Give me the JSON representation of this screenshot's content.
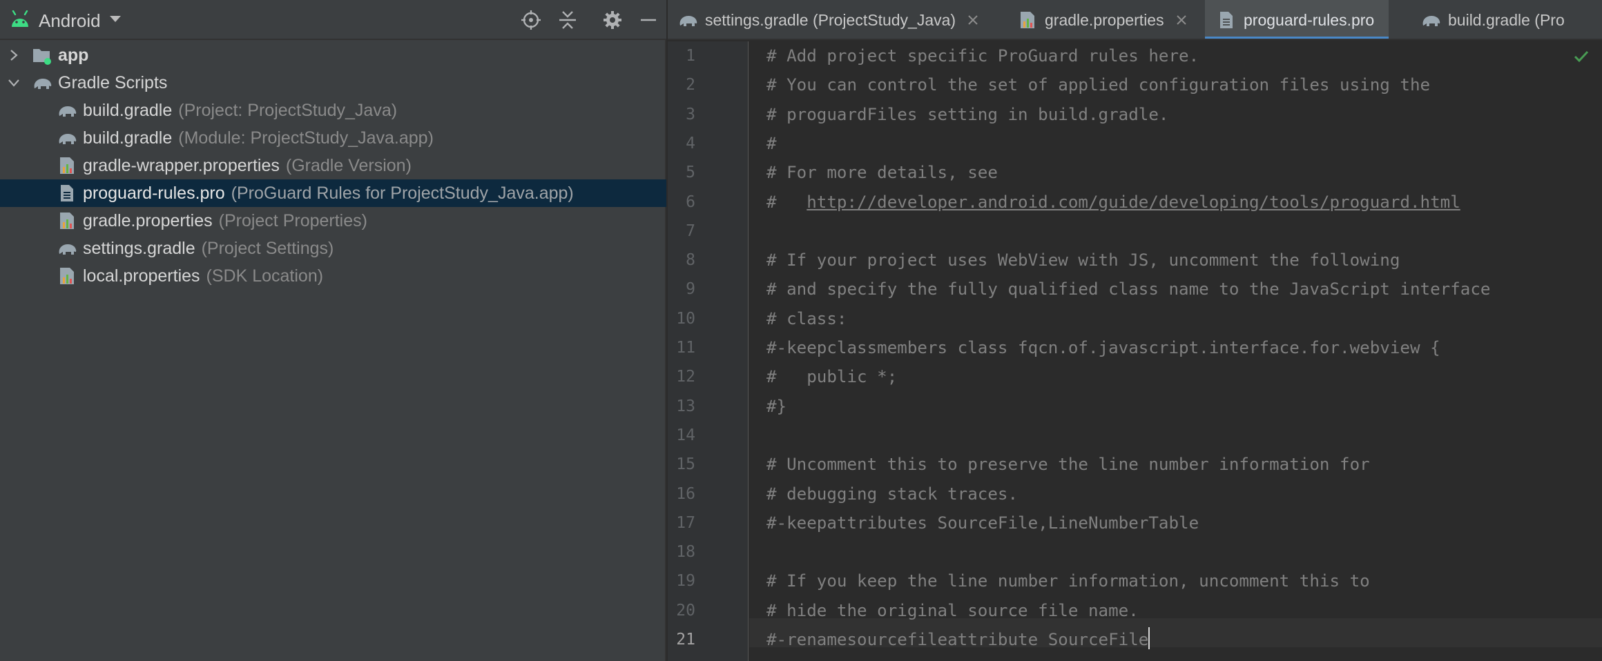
{
  "project_panel": {
    "view_mode": "Android",
    "toolbar_icons": [
      "locate-target-icon",
      "collapse-all-icon",
      "gear-icon",
      "hide-minus-icon"
    ],
    "tree": [
      {
        "name": "app",
        "hint": "",
        "icon": "module-folder-icon",
        "expand": "collapsed"
      },
      {
        "name": "Gradle Scripts",
        "hint": "",
        "icon": "gradle-elephant-icon",
        "expand": "expanded"
      },
      {
        "name": "build.gradle",
        "hint": "(Project: ProjectStudy_Java)",
        "icon": "gradle-elephant-icon"
      },
      {
        "name": "build.gradle",
        "hint": "(Module: ProjectStudy_Java.app)",
        "icon": "gradle-elephant-icon"
      },
      {
        "name": "gradle-wrapper.properties",
        "hint": "(Gradle Version)",
        "icon": "properties-file-icon"
      },
      {
        "name": "proguard-rules.pro",
        "hint": "(ProGuard Rules for ProjectStudy_Java.app)",
        "icon": "text-file-icon",
        "selected": true
      },
      {
        "name": "gradle.properties",
        "hint": "(Project Properties)",
        "icon": "properties-file-icon"
      },
      {
        "name": "settings.gradle",
        "hint": "(Project Settings)",
        "icon": "gradle-elephant-icon"
      },
      {
        "name": "local.properties",
        "hint": "(SDK Location)",
        "icon": "properties-file-icon"
      }
    ]
  },
  "editor": {
    "tabs": [
      {
        "label": "settings.gradle (ProjectStudy_Java)",
        "icon": "gradle-elephant-icon",
        "closable": true
      },
      {
        "label": "gradle.properties",
        "icon": "properties-file-icon",
        "closable": true
      },
      {
        "label": "proguard-rules.pro",
        "icon": "text-file-icon",
        "closable": false,
        "active": true
      },
      {
        "label": "build.gradle (Pro",
        "icon": "gradle-elephant-icon",
        "closable": false
      }
    ],
    "current_line": 21,
    "lines": [
      "# Add project specific ProGuard rules here.",
      "# You can control the set of applied configuration files using the",
      "# proguardFiles setting in build.gradle.",
      "#",
      "# For more details, see",
      "#   http://developer.android.com/guide/developing/tools/proguard.html",
      "",
      "# If your project uses WebView with JS, uncomment the following",
      "# and specify the fully qualified class name to the JavaScript interface",
      "# class:",
      "#-keepclassmembers class fqcn.of.javascript.interface.for.webview {",
      "#   public *;",
      "#}",
      "",
      "# Uncomment this to preserve the line number information for",
      "# debugging stack traces.",
      "#-keepattributes SourceFile,LineNumberTable",
      "",
      "# If you keep the line number information, uncomment this to",
      "# hide the original source file name.",
      "#-renamesourcefileattribute SourceFile"
    ],
    "link": {
      "line": 6,
      "prefix": "#   ",
      "url": "http://developer.android.com/guide/developing/tools/proguard.html"
    }
  },
  "colors": {
    "panel_bg": "#3c3f41",
    "editor_bg": "#2b2b2b",
    "selection_bg": "#0d293e",
    "comment": "#808080",
    "active_tab_underline": "#4a88c7"
  }
}
